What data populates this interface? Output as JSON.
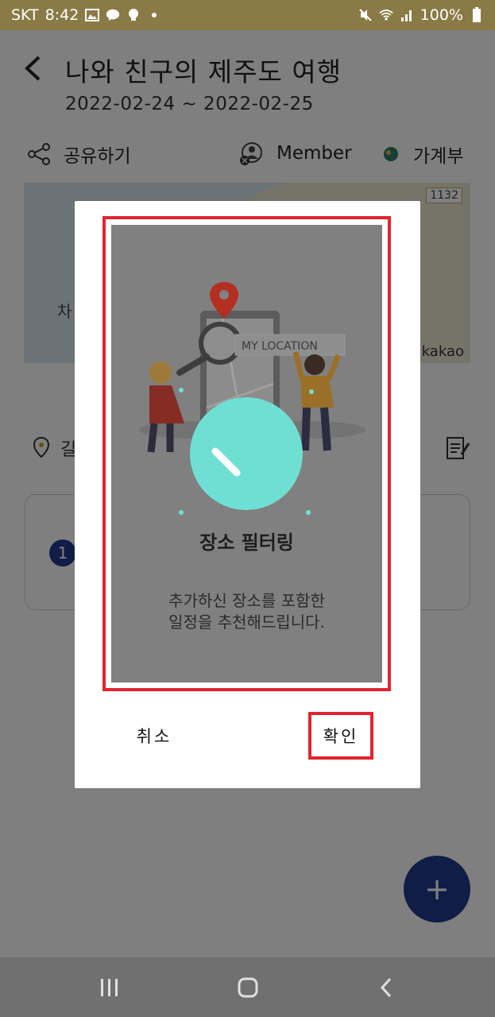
{
  "status_bar": {
    "carrier": "SKT",
    "time": "8:42",
    "battery": "100%",
    "left_icons": [
      "image-icon",
      "talk-icon",
      "bulb-icon",
      "dot-icon"
    ],
    "right_icons": [
      "mute-icon",
      "wifi-icon",
      "signal-icon",
      "battery-icon"
    ]
  },
  "header": {
    "title": "나와 친구의 제주도 여행",
    "dates": "2022-02-24 ~ 2022-02-25"
  },
  "actions": {
    "share_label": "공유하기",
    "member_label": "Member",
    "ledger_label": "가계부"
  },
  "map": {
    "road_number": "1132",
    "partial_label": "차",
    "attribution": "kakao"
  },
  "place_row": {
    "partial_text": "길"
  },
  "card": {
    "index": "1"
  },
  "fab": {
    "label": "+"
  },
  "dialog": {
    "illustration_label": "MY LOCATION",
    "title": "장소 필터링",
    "description_line1": "추가하신 장소를 포함한",
    "description_line2": "일정을 추천해드립니다.",
    "cancel_label": "취소",
    "confirm_label": "확인"
  },
  "colors": {
    "status_bar": "#8a7a45",
    "accent_blue": "#1f3b8f",
    "highlight_red": "#e02530",
    "illustration_bg": "#808080",
    "teal_circle": "#6fdfd3"
  }
}
